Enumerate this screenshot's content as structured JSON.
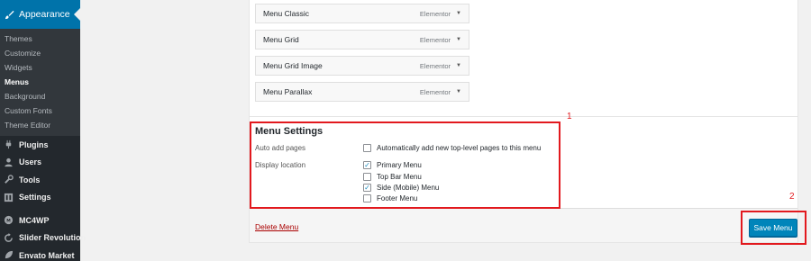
{
  "sidebar": {
    "active": {
      "label": "Appearance",
      "icon": "paintbrush-icon"
    },
    "submenu": [
      {
        "label": "Themes"
      },
      {
        "label": "Customize"
      },
      {
        "label": "Widgets"
      },
      {
        "label": "Menus"
      },
      {
        "label": "Background"
      },
      {
        "label": "Custom Fonts"
      },
      {
        "label": "Theme Editor"
      }
    ],
    "items": [
      {
        "label": "Plugins",
        "icon": "plug-icon"
      },
      {
        "label": "Users",
        "icon": "users-icon"
      },
      {
        "label": "Tools",
        "icon": "wrench-icon"
      },
      {
        "label": "Settings",
        "icon": "settings-icon"
      },
      {
        "label": "MC4WP",
        "icon": "mc4wp-icon"
      },
      {
        "label": "Slider Revolution",
        "icon": "refresh-icon"
      },
      {
        "label": "Envato Market",
        "icon": "leaf-icon"
      }
    ]
  },
  "menu_items": [
    {
      "title": "Menu Classic",
      "type": "Elementor"
    },
    {
      "title": "Menu Grid",
      "type": "Elementor"
    },
    {
      "title": "Menu Grid Image",
      "type": "Elementor"
    },
    {
      "title": "Menu Parallax",
      "type": "Elementor"
    }
  ],
  "settings": {
    "title": "Menu Settings",
    "auto_add_label": "Auto add pages",
    "auto_add_option": {
      "label": "Automatically add new top-level pages to this menu",
      "checked": false
    },
    "display_location_label": "Display location",
    "locations": [
      {
        "label": "Primary Menu",
        "checked": true
      },
      {
        "label": "Top Bar Menu",
        "checked": false
      },
      {
        "label": "Side (Mobile) Menu",
        "checked": true
      },
      {
        "label": "Footer Menu",
        "checked": false
      }
    ]
  },
  "footer": {
    "delete_label": "Delete Menu",
    "save_label": "Save Menu"
  },
  "annotations": {
    "one": "1",
    "two": "2"
  },
  "colors": {
    "accent": "#0073aa",
    "annotation": "#e2191e",
    "delete": "#aa0000",
    "save": "#0085ba"
  }
}
